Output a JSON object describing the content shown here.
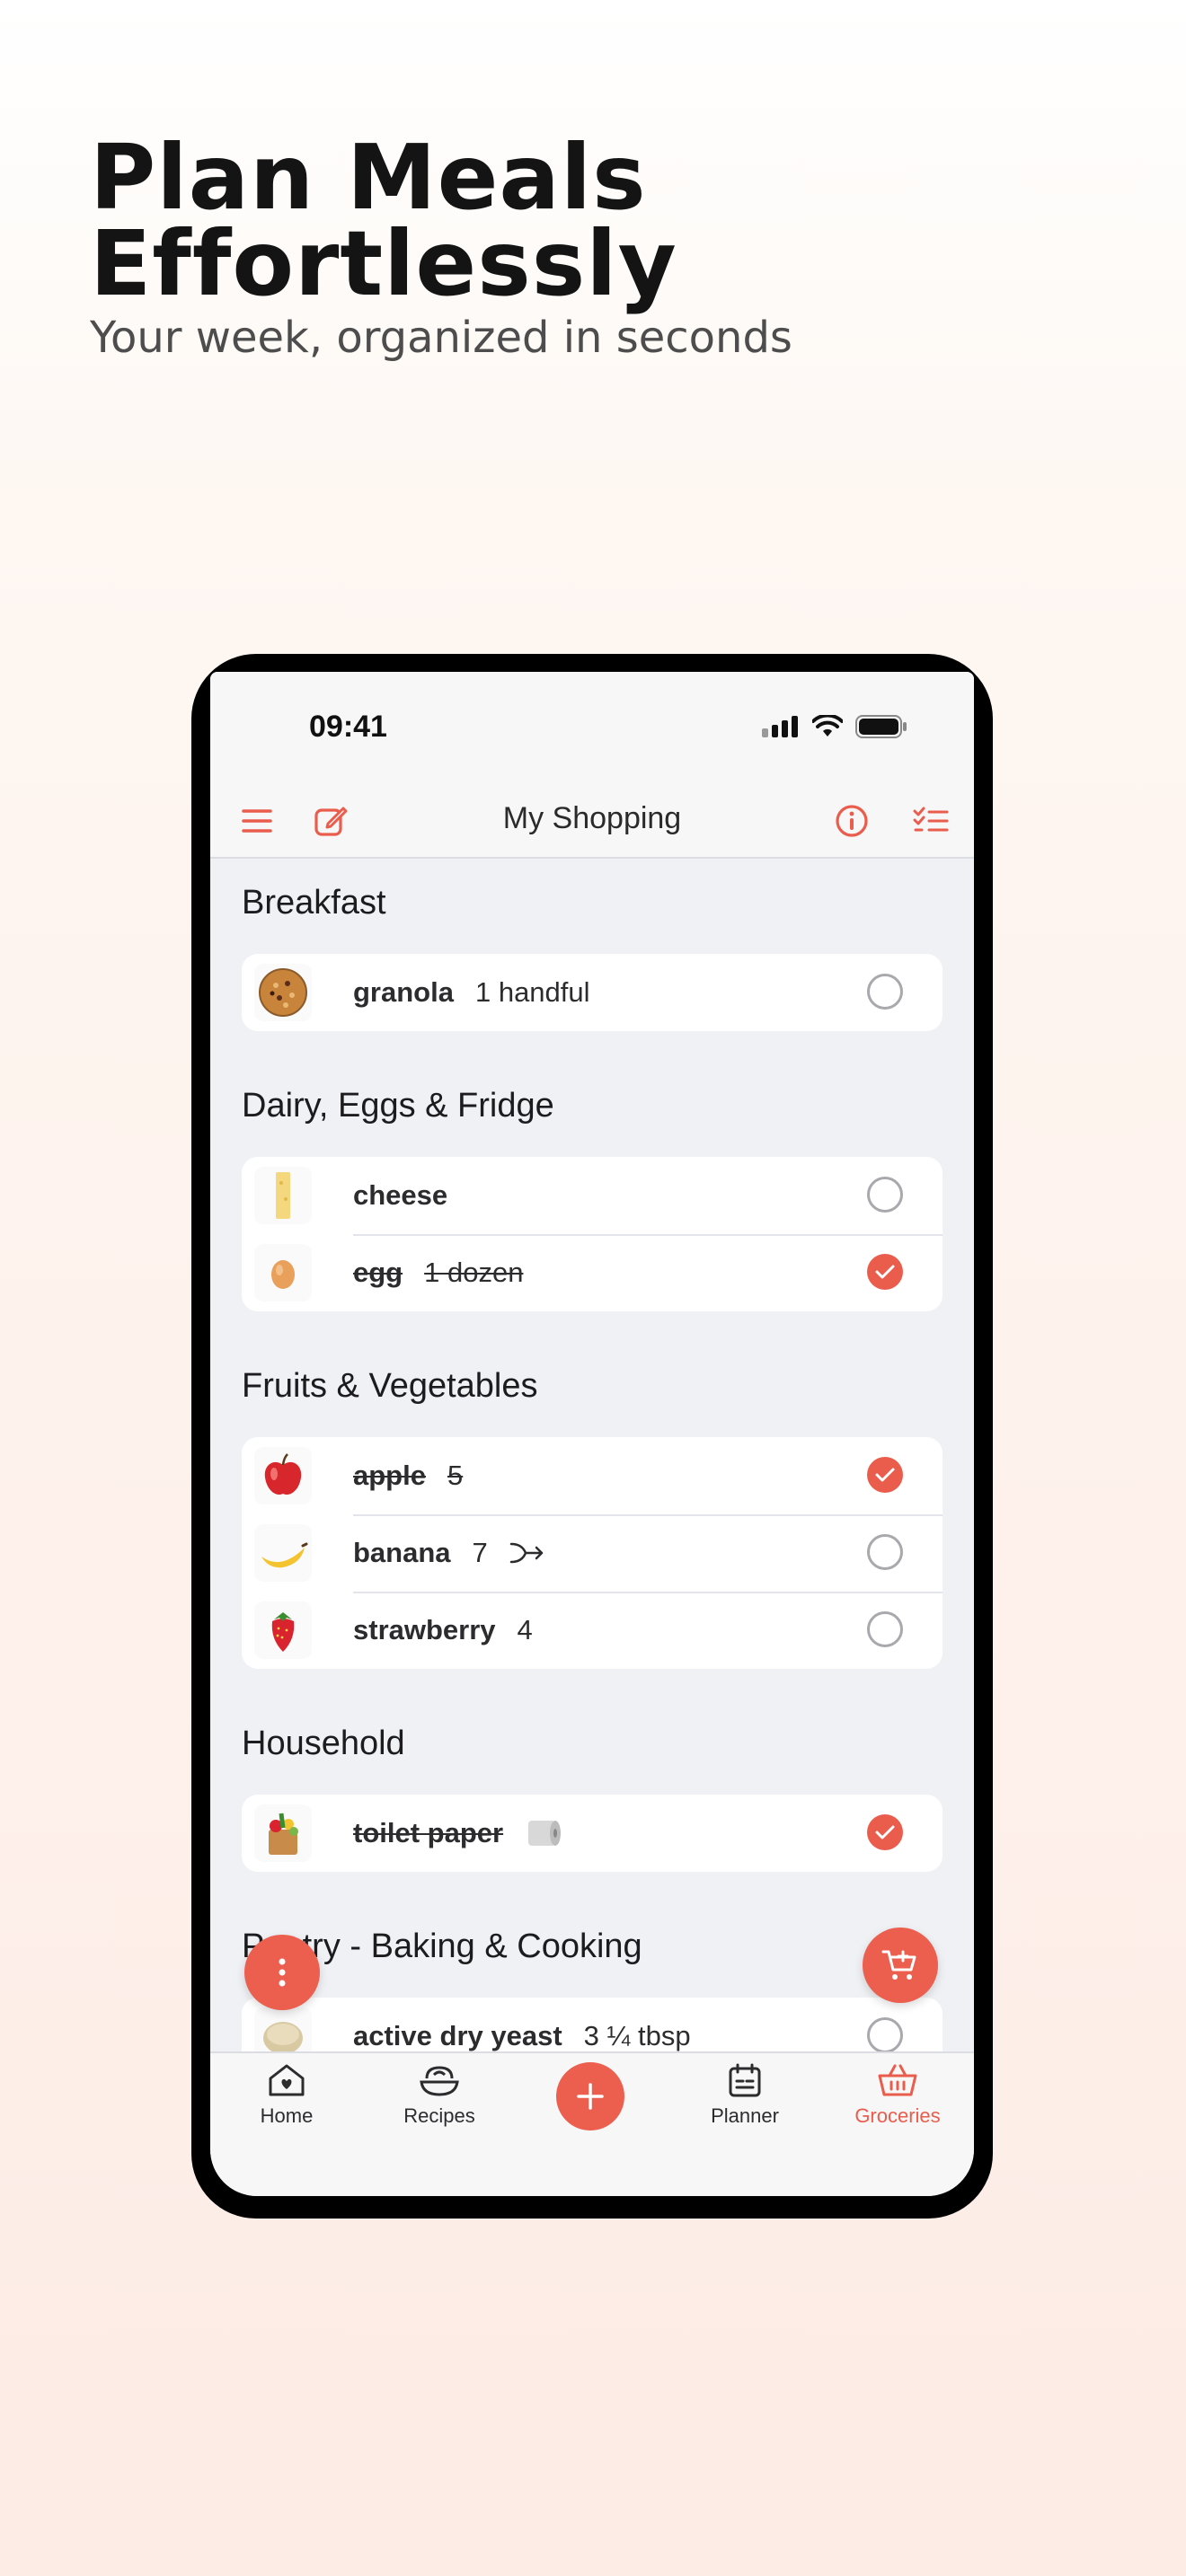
{
  "hero": {
    "title_line1": "Plan Meals",
    "title_line2": "Effortlessly",
    "subtitle": "Your week, organized in seconds"
  },
  "status_bar": {
    "time": "09:41"
  },
  "nav": {
    "title": "My Shopping"
  },
  "sections": [
    {
      "title": "Breakfast",
      "items": [
        {
          "name": "granola",
          "qty": "1 handful",
          "checked": false
        }
      ]
    },
    {
      "title": "Dairy, Eggs & Fridge",
      "items": [
        {
          "name": "cheese",
          "qty": "",
          "checked": false
        },
        {
          "name": "egg",
          "qty": "1 dozen",
          "checked": true
        }
      ]
    },
    {
      "title": "Fruits & Vegetables",
      "items": [
        {
          "name": "apple",
          "qty": "5",
          "checked": true
        },
        {
          "name": "banana",
          "qty": "7",
          "checked": false
        },
        {
          "name": "strawberry",
          "qty": "4",
          "checked": false
        }
      ]
    },
    {
      "title": "Household",
      "items": [
        {
          "name": "toilet paper",
          "qty": "",
          "checked": true
        }
      ]
    },
    {
      "title": "Pantry - Baking & Cooking",
      "items": [
        {
          "name": "active dry yeast",
          "qty": "3 ¼ tbsp",
          "checked": false
        }
      ]
    }
  ],
  "tabs": [
    {
      "label": "Home",
      "icon": "home-icon"
    },
    {
      "label": "Recipes",
      "icon": "recipes-icon"
    },
    {
      "label": "Planner",
      "icon": "planner-icon"
    },
    {
      "label": "Groceries",
      "icon": "basket-icon",
      "active": true
    }
  ],
  "colors": {
    "accent": "#ea5d4d",
    "background": "#f0f1f5",
    "text": "#2c2c2e"
  }
}
